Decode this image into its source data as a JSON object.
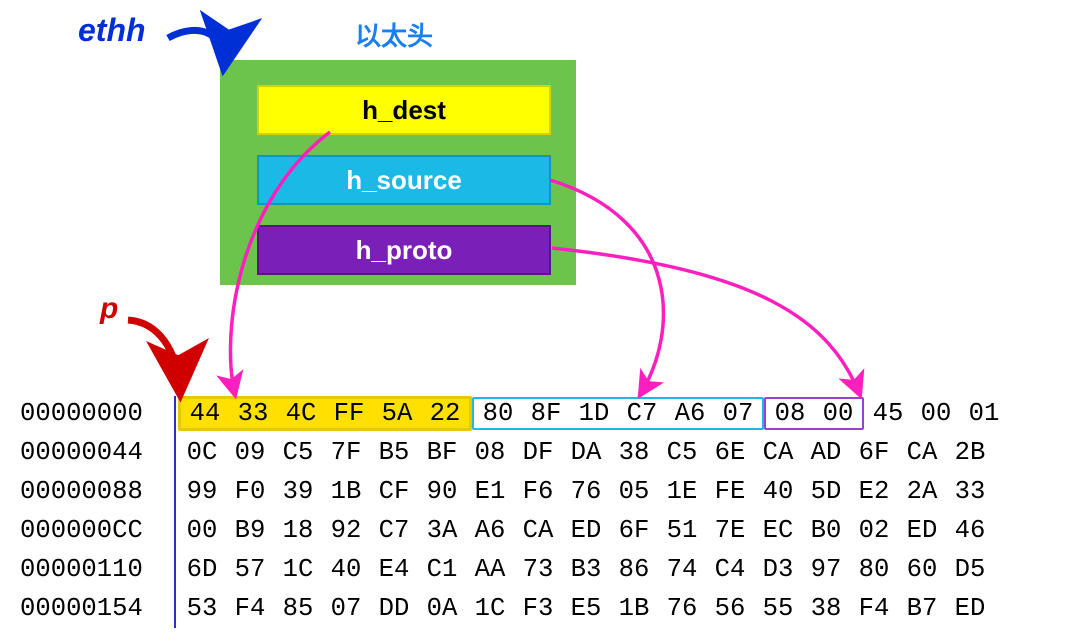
{
  "labels": {
    "ethh": "ethh",
    "title": "以太头",
    "p": "p"
  },
  "fields": {
    "dest": "h_dest",
    "source": "h_source",
    "proto": "h_proto"
  },
  "hex": {
    "offsets": [
      "00000000",
      "00000044",
      "00000088",
      "000000CC",
      "00000110",
      "00000154"
    ],
    "rows": [
      [
        "44",
        "33",
        "4C",
        "FF",
        "5A",
        "22",
        "80",
        "8F",
        "1D",
        "C7",
        "A6",
        "07",
        "08",
        "00",
        "45",
        "00",
        "01"
      ],
      [
        "0C",
        "09",
        "C5",
        "7F",
        "B5",
        "BF",
        "08",
        "DF",
        "DA",
        "38",
        "C5",
        "6E",
        "CA",
        "AD",
        "6F",
        "CA",
        "2B"
      ],
      [
        "99",
        "F0",
        "39",
        "1B",
        "CF",
        "90",
        "E1",
        "F6",
        "76",
        "05",
        "1E",
        "FE",
        "40",
        "5D",
        "E2",
        "2A",
        "33"
      ],
      [
        "00",
        "B9",
        "18",
        "92",
        "C7",
        "3A",
        "A6",
        "CA",
        "ED",
        "6F",
        "51",
        "7E",
        "EC",
        "B0",
        "02",
        "ED",
        "46"
      ],
      [
        "6D",
        "57",
        "1C",
        "40",
        "E4",
        "C1",
        "AA",
        "73",
        "B3",
        "86",
        "74",
        "C4",
        "D3",
        "97",
        "80",
        "60",
        "D5"
      ],
      [
        "53",
        "F4",
        "85",
        "07",
        "DD",
        "0A",
        "1C",
        "F3",
        "E5",
        "1B",
        "76",
        "56",
        "55",
        "38",
        "F4",
        "B7",
        "ED"
      ]
    ],
    "dest_cols": [
      0,
      1,
      2,
      3,
      4,
      5
    ],
    "source_cols": [
      6,
      7,
      8,
      9,
      10,
      11
    ],
    "proto_cols": [
      12,
      13
    ]
  }
}
